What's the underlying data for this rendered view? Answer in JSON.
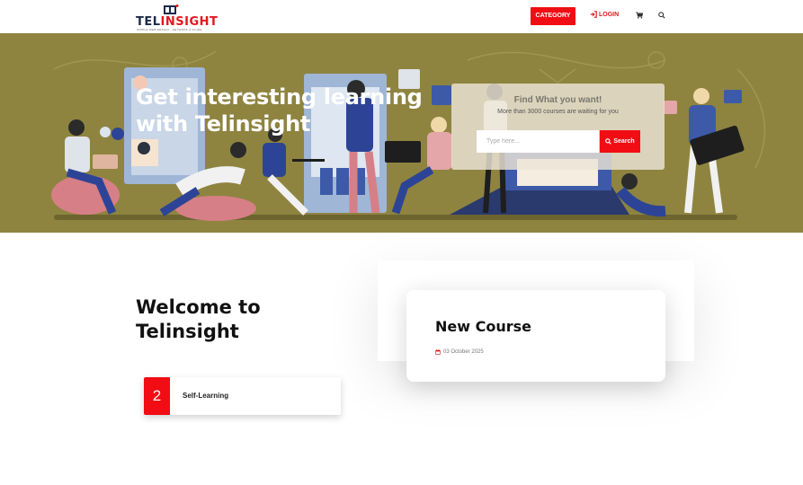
{
  "header": {
    "logo_tel": "TEL",
    "logo_insight": "INSIGHT",
    "logo_tagline": "SIMPLE WEB DESIGN · NETWORK & GUIDE",
    "category_label": "CATEGORY",
    "login_label": "LOGIN",
    "icons": [
      "login-icon",
      "cart-icon",
      "search-icon"
    ]
  },
  "hero": {
    "title": "Get interesting learning with Telinsight",
    "search": {
      "title": "Find What you want!",
      "subtitle": "More than 3000 courses are waiting for you",
      "placeholder": "Type here...",
      "button_label": "Search"
    }
  },
  "welcome": {
    "title": "Welcome to Telinsight",
    "feature": {
      "number": "2",
      "label": "Self-Learning"
    }
  },
  "course": {
    "title": "New Course",
    "date": "03 October 2025"
  },
  "colors": {
    "accent": "#f20c14",
    "hero_bg": "#8e8440",
    "logo_dark": "#1b2a4a"
  }
}
